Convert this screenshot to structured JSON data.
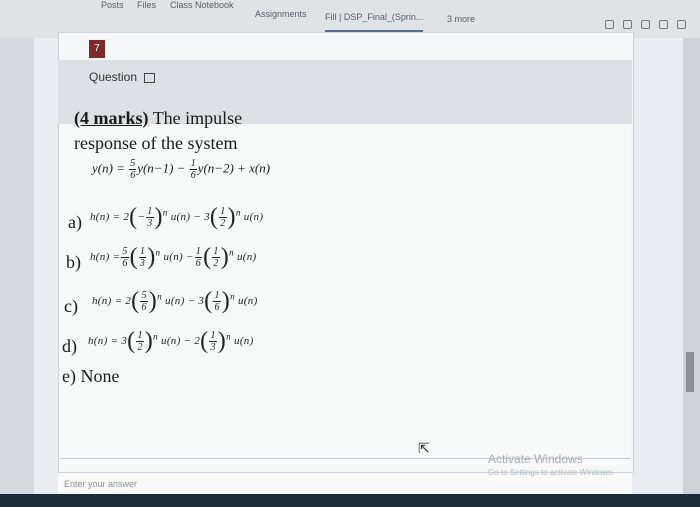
{
  "tabs": [
    "Posts",
    "Files",
    "Class Notebook",
    "Assignments",
    "Fill | DSP_Final_(Sprin...",
    "3 more"
  ],
  "active_tab_index": 4,
  "question": {
    "number": "7",
    "label": "Question",
    "marks": "(4  marks)",
    "prompt_1": "The impulse",
    "prompt_2": "response of the system"
  },
  "system_eq": {
    "lhs": "y(n) =",
    "c1_num": "5",
    "c1_den": "6",
    "t1": "y(n−1) −",
    "c2_num": "1",
    "c2_den": "6",
    "t2": "y(n−2) + x(n)"
  },
  "options": [
    {
      "label": "a)",
      "lhs": "h(n) = 2",
      "f1_num": "1",
      "f1_den": "3",
      "f1_sign": "−",
      "mid": "u(n) − 3",
      "f2_num": "1",
      "f2_den": "2",
      "end": "u(n)"
    },
    {
      "label": "b)",
      "lhs": "h(n) =",
      "c1_num": "5",
      "c1_den": "6",
      "f1_num": "1",
      "f1_den": "3",
      "f1_sign": "",
      "mid": "u(n) −",
      "c2_num": "1",
      "c2_den": "6",
      "f2_num": "1",
      "f2_den": "2",
      "end": "u(n)"
    },
    {
      "label": "c)",
      "lhs": "h(n) = 2",
      "f1_num": "5",
      "f1_den": "6",
      "f1_sign": "",
      "mid": "u(n) − 3",
      "f2_num": "1",
      "f2_den": "6",
      "end": "u(n)"
    },
    {
      "label": "d)",
      "lhs": "h(n) = 3",
      "f1_num": "1",
      "f1_den": "2",
      "f1_sign": "",
      "mid": "u(n) − 2",
      "f2_num": "1",
      "f2_den": "3",
      "end": "u(n)"
    },
    {
      "label": "e)",
      "text": "None"
    }
  ],
  "answer_placeholder": "Enter your answer",
  "watermark": {
    "line1": "Activate Windows",
    "line2": "Go to Settings to activate Windows."
  }
}
